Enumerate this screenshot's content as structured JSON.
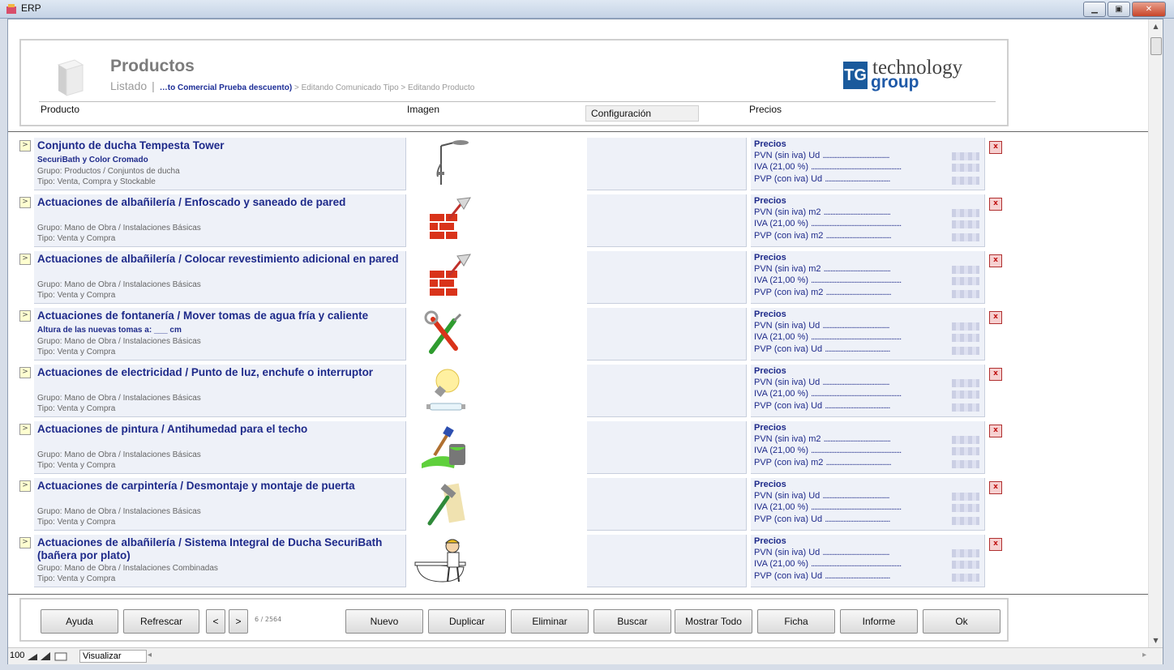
{
  "window": {
    "title": "ERP"
  },
  "header": {
    "title": "Productos",
    "subtitle": "Listado",
    "separator": "|",
    "crumb_strong": "…to Comercial Prueba descuento)",
    "crumb_rest": " > Editando Comunicado Tipo > Editando Producto",
    "logo_letters": "TG",
    "logo_line1": "technology",
    "logo_line2": "group",
    "columns": {
      "producto": "Producto",
      "imagen": "Imagen",
      "configuracion": "Configuración",
      "precios": "Precios"
    }
  },
  "products": [
    {
      "title": "Conjunto de ducha Tempesta Tower",
      "subtitle": "SecuriBath y Color Cromado",
      "grupo": "Grupo: Productos / Conjuntos de ducha",
      "tipo": "Tipo: Venta, Compra y Stockable",
      "image": "shower-icon",
      "prices_title": "Precios",
      "pvn": "PVN (sin iva) Ud",
      "iva": "IVA (21,00 %)",
      "pvp": "PVP (con iva) Ud"
    },
    {
      "title": "Actuaciones de albañilería / Enfoscado y saneado de pared",
      "subtitle": "",
      "grupo": "Grupo: Mano de Obra / Instalaciones Básicas",
      "tipo": "Tipo: Venta y Compra",
      "image": "bricks-trowel-icon",
      "prices_title": "Precios",
      "pvn": "PVN (sin iva) m2",
      "iva": "IVA (21,00 %)",
      "pvp": "PVP (con iva) m2"
    },
    {
      "title": "Actuaciones de albañilería / Colocar revestimiento adicional en pared",
      "subtitle": "",
      "grupo": "Grupo: Mano de Obra / Instalaciones Básicas",
      "tipo": "Tipo: Venta y Compra",
      "image": "bricks-trowel-icon",
      "prices_title": "Precios",
      "pvn": "PVN (sin iva) m2",
      "iva": "IVA (21,00 %)",
      "pvp": "PVP (con iva) m2"
    },
    {
      "title": "Actuaciones de fontanería / Mover tomas de agua fría y caliente",
      "subtitle": "Altura de las nuevas tomas a: ___ cm",
      "grupo": "Grupo: Mano de Obra / Instalaciones Básicas",
      "tipo": "Tipo: Venta y Compra",
      "image": "tools-icon",
      "prices_title": "Precios",
      "pvn": "PVN (sin iva) Ud",
      "iva": "IVA (21,00 %)",
      "pvp": "PVP (con iva) Ud"
    },
    {
      "title": "Actuaciones de electricidad / Punto de luz, enchufe o interruptor",
      "subtitle": "",
      "grupo": "Grupo: Mano de Obra / Instalaciones Básicas",
      "tipo": "Tipo: Venta y Compra",
      "image": "lightbulb-icon",
      "prices_title": "Precios",
      "pvn": "PVN (sin iva) Ud",
      "iva": "IVA (21,00 %)",
      "pvp": "PVP (con iva) Ud"
    },
    {
      "title": "Actuaciones de pintura / Antihumedad para el techo",
      "subtitle": "",
      "grupo": "Grupo: Mano de Obra / Instalaciones Básicas",
      "tipo": "Tipo: Venta y Compra",
      "image": "paint-icon",
      "prices_title": "Precios",
      "pvn": "PVN (sin iva) m2",
      "iva": "IVA (21,00 %)",
      "pvp": "PVP (con iva) m2"
    },
    {
      "title": "Actuaciones de carpintería / Desmontaje y montaje de puerta",
      "subtitle": "",
      "grupo": "Grupo: Mano de Obra / Instalaciones Básicas",
      "tipo": "Tipo: Venta y Compra",
      "image": "hammer-icon",
      "prices_title": "Precios",
      "pvn": "PVN (sin iva) Ud",
      "iva": "IVA (21,00 %)",
      "pvp": "PVP (con iva) Ud"
    },
    {
      "title": "Actuaciones de albañilería / Sistema Integral de Ducha SecuriBath (bañera por plato)",
      "subtitle": "",
      "grupo": "Grupo: Mano de Obra / Instalaciones Combinadas",
      "tipo": "Tipo: Venta y Compra",
      "image": "worker-bathtub-icon",
      "prices_title": "Precios",
      "pvn": "PVN (sin iva) Ud",
      "iva": "IVA (21,00 %)",
      "pvp": "PVP (con iva) Ud"
    }
  ],
  "row_controls": {
    "expand": ">",
    "delete": "x"
  },
  "footer": {
    "ayuda": "Ayuda",
    "refrescar": "Refrescar",
    "prev": "<",
    "next": ">",
    "pager": "6 / 2564",
    "nuevo": "Nuevo",
    "duplicar": "Duplicar",
    "eliminar": "Eliminar",
    "buscar": "Buscar",
    "mostrar_todo": "Mostrar Todo",
    "ficha": "Ficha",
    "informe": "Informe",
    "ok": "Ok"
  },
  "statusbar": {
    "zoom": "100",
    "view": "Visualizar"
  },
  "colors": {
    "accent": "#1e2a8a",
    "row_bg": "#eef1f8",
    "delete": "#c01010"
  }
}
